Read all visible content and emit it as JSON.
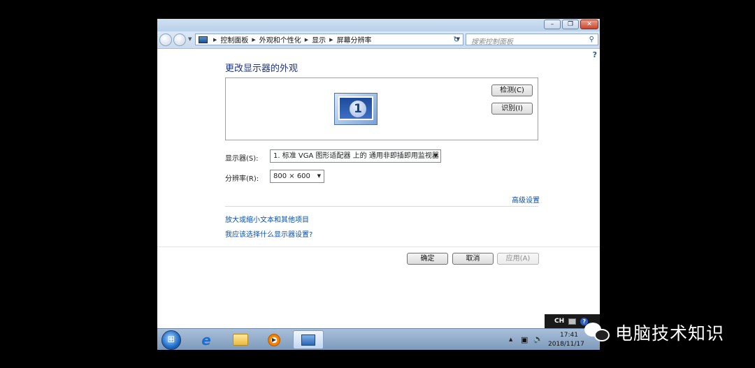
{
  "window": {
    "minimize_label": "–",
    "maximize_label": "❐",
    "close_label": "✕"
  },
  "address_bar": {
    "breadcrumbs": [
      "控制面板",
      "外观和个性化",
      "显示",
      "屏幕分辨率"
    ],
    "search_placeholder": "搜索控制面板"
  },
  "content": {
    "title": "更改显示器的外观",
    "monitor_number": "1",
    "detect_button": "检测(C)",
    "identify_button": "识别(I)",
    "display_label": "显示器(S):",
    "display_value": "1. 标准 VGA 图形适配器 上的 通用非即插即用监视器",
    "resolution_label": "分辨率(R):",
    "resolution_value": "800 × 600",
    "advanced_link": "高级设置",
    "links": [
      "放大或缩小文本和其他项目",
      "我应该选择什么显示器设置?"
    ]
  },
  "buttons": {
    "ok": "确定",
    "cancel": "取消",
    "apply": "应用(A)"
  },
  "ime": {
    "lang": "CH"
  },
  "taskbar": {
    "time": "17:41",
    "date": "2018/11/17"
  },
  "watermark": {
    "text": "电脑技术知识"
  }
}
